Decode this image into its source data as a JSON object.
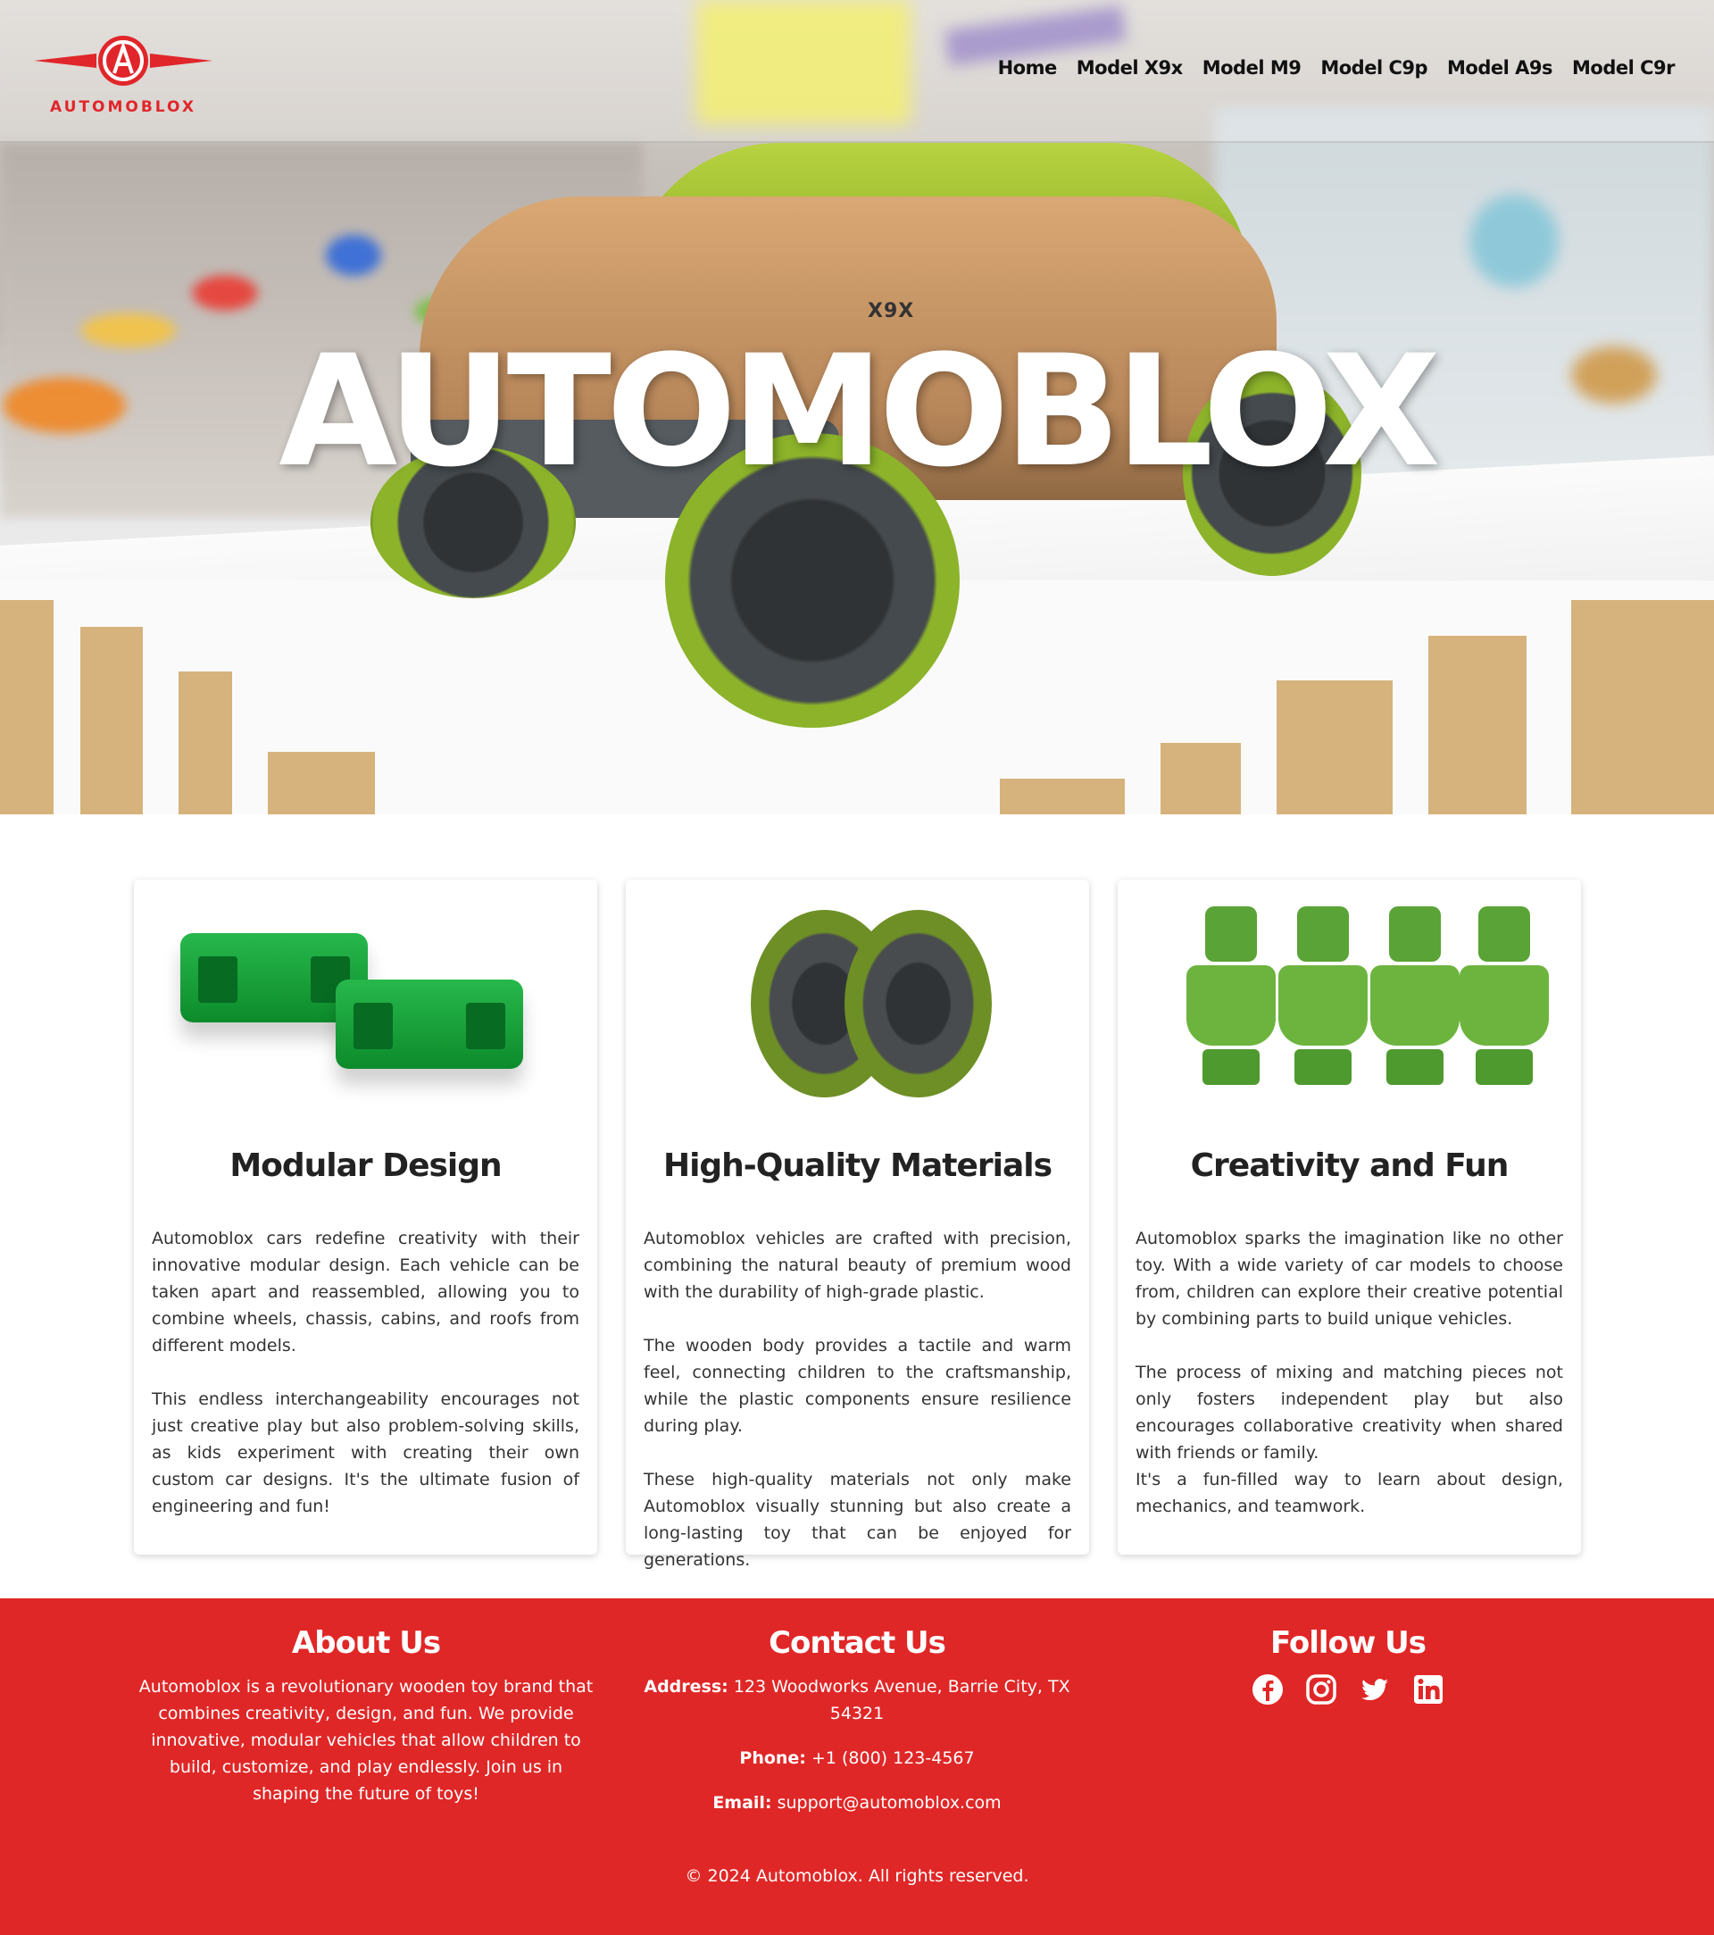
{
  "brand": {
    "name": "AUTOMOBLOX",
    "accent_color": "#e02727"
  },
  "nav": {
    "items": [
      "Home",
      "Model X9x",
      "Model M9",
      "Model C9p",
      "Model A9s",
      "Model C9r"
    ]
  },
  "hero": {
    "title": "AUTOMOBLOX",
    "model_badge": "X9X"
  },
  "cards": [
    {
      "image": "green-connector-blocks",
      "title": "Modular Design",
      "paragraphs": [
        "Automoblox cars redefine creativity with their innovative modular design. Each vehicle can be taken apart and reassembled, allowing you to combine wheels, chassis, cabins, and roofs from different models.",
        "This endless interchangeability encourages not just creative play but also problem-solving skills, as kids experiment with creating their own custom car designs. It's the ultimate fusion of engineering and fun!"
      ]
    },
    {
      "image": "green-wheels",
      "title": "High-Quality Materials",
      "paragraphs": [
        "Automoblox vehicles are crafted with precision, combining the natural beauty of premium wood with the durability of high-grade plastic.",
        "The wooden body provides a tactile and warm feel, connecting children to the craftsmanship, while the plastic components ensure resilience during play.",
        "These high-quality materials not only make Automoblox visually stunning but also create a long-lasting toy that can be enjoyed for generations."
      ]
    },
    {
      "image": "green-figures",
      "title": "Creativity and Fun",
      "paragraphs": [
        "Automoblox sparks the imagination like no other toy. With a wide variety of car models to choose from, children can explore their creative potential by combining parts to build unique vehicles.",
        "The process of mixing and matching pieces not only fosters independent play but also encourages collaborative creativity when shared with friends or family.",
        "It's a fun-filled way to learn about design, mechanics, and teamwork."
      ]
    }
  ],
  "footer": {
    "about": {
      "title": "About Us",
      "text": "Automoblox is a revolutionary wooden toy brand that combines creativity, design, and fun. We provide innovative, modular vehicles that allow children to build, customize, and play endlessly. Join us in shaping the future of toys!"
    },
    "contact": {
      "title": "Contact Us",
      "address_label": "Address:",
      "address": "123 Woodworks Avenue, Barrie City, TX 54321",
      "phone_label": "Phone:",
      "phone": "+1 (800) 123-4567",
      "email_label": "Email:",
      "email": "support@automoblox.com"
    },
    "follow": {
      "title": "Follow Us",
      "icons": [
        "facebook-icon",
        "instagram-icon",
        "twitter-icon",
        "linkedin-icon"
      ]
    },
    "copyright": "© 2024 Automoblox. All rights reserved."
  }
}
